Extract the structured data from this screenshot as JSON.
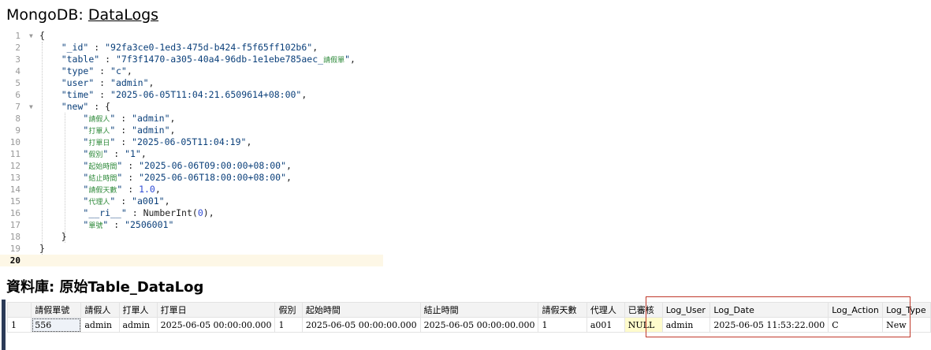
{
  "heading1": {
    "prefix": "MongoDB: ",
    "collection": "DataLogs"
  },
  "heading2": {
    "text": "資料庫: 原始Table_DataLog"
  },
  "editor": {
    "lines": [
      {
        "n": "1",
        "fold": true
      },
      {
        "n": "2"
      },
      {
        "n": "3"
      },
      {
        "n": "4"
      },
      {
        "n": "5"
      },
      {
        "n": "6"
      },
      {
        "n": "7",
        "fold": true
      },
      {
        "n": "8"
      },
      {
        "n": "9"
      },
      {
        "n": "10"
      },
      {
        "n": "11"
      },
      {
        "n": "12"
      },
      {
        "n": "13"
      },
      {
        "n": "14"
      },
      {
        "n": "15"
      },
      {
        "n": "16"
      },
      {
        "n": "17"
      },
      {
        "n": "18"
      },
      {
        "n": "19"
      },
      {
        "n": "20",
        "active": true
      }
    ],
    "doc": {
      "open": "{",
      "id_key": "\"_id\"",
      "id_val": "\"92fa3ce0-1ed3-475d-b424-f5f65ff102b6\"",
      "table_key": "\"table\"",
      "table_val_a": "\"7f3f1470-a305-40a4-96db-1e1ebe785aec_",
      "table_val_cjk": "請假單",
      "table_val_b": "\"",
      "type_key": "\"type\"",
      "type_val": "\"c\"",
      "user_key": "\"user\"",
      "user_val": "\"admin\"",
      "time_key": "\"time\"",
      "time_val": "\"2025-06-05T11:04:21.6509614+08:00\"",
      "new_key": "\"new\"",
      "new_open": "{",
      "f1_key": "請假人",
      "f1_val": "\"admin\"",
      "f2_key": "打單人",
      "f2_val": "\"admin\"",
      "f3_key": "打單日",
      "f3_val": "\"2025-06-05T11:04:19\"",
      "f4_key": "假別",
      "f4_val": "\"1\"",
      "f5_key": "起始時間",
      "f5_val": "\"2025-06-06T09:00:00+08:00\"",
      "f6_key": "結止時間",
      "f6_val": "\"2025-06-06T18:00:00+08:00\"",
      "f7_key": "請假天數",
      "f7_val": "1.0",
      "f8_key": "代理人",
      "f8_val": "\"a001\"",
      "ri_key": "\"__ri__\"",
      "ri_fn": "NumberInt(",
      "ri_num": "0",
      "ri_close": ")",
      "f9_key": "單號",
      "f9_val": "\"2506001\"",
      "new_close": "}",
      "close": "}",
      "colon": " : ",
      "comma": ","
    }
  },
  "grid": {
    "columns": [
      "請假單號",
      "請假人",
      "打單人",
      "打單日",
      "假別",
      "起始時間",
      "結止時間",
      "請假天數",
      "代理人",
      "已審核",
      "Log_User",
      "Log_Date",
      "Log_Action",
      "Log_Type"
    ],
    "rows": [
      {
        "num": "1",
        "cells": [
          "556",
          "admin",
          "admin",
          "2025-06-05 00:00:00.000",
          "1",
          "2025-06-05 00:00:00.000",
          "2025-06-05 00:00:00.000",
          "1",
          "a001",
          "NULL",
          "admin",
          "2025-06-05 11:53:22.000",
          "C",
          "New"
        ]
      }
    ]
  },
  "colors": {
    "highlight_border": "#c0392b",
    "null_bg": "#fffccc",
    "string": "#0a3f7a",
    "cjk_key": "#2e8a3a",
    "number": "#2f4bd6"
  }
}
